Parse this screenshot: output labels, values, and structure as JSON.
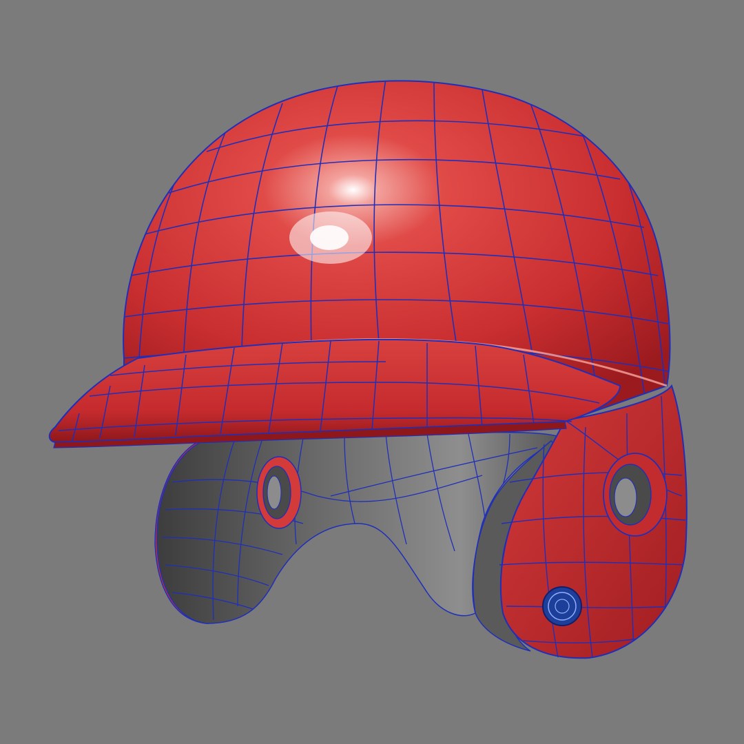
{
  "scene": {
    "subject": "baseball-batting-helmet",
    "render_style": "shaded-wireframe",
    "colors": {
      "background": "#7b7b7b",
      "shell": "#d43a3a",
      "shell_dark": "#a51e22",
      "shell_light": "#f06a66",
      "liner": "#5c5c5c",
      "liner_dark": "#3e3e3e",
      "liner_light": "#8a8a8a",
      "wire": "#1f2fb8",
      "badge": "#1d3f9a"
    }
  }
}
